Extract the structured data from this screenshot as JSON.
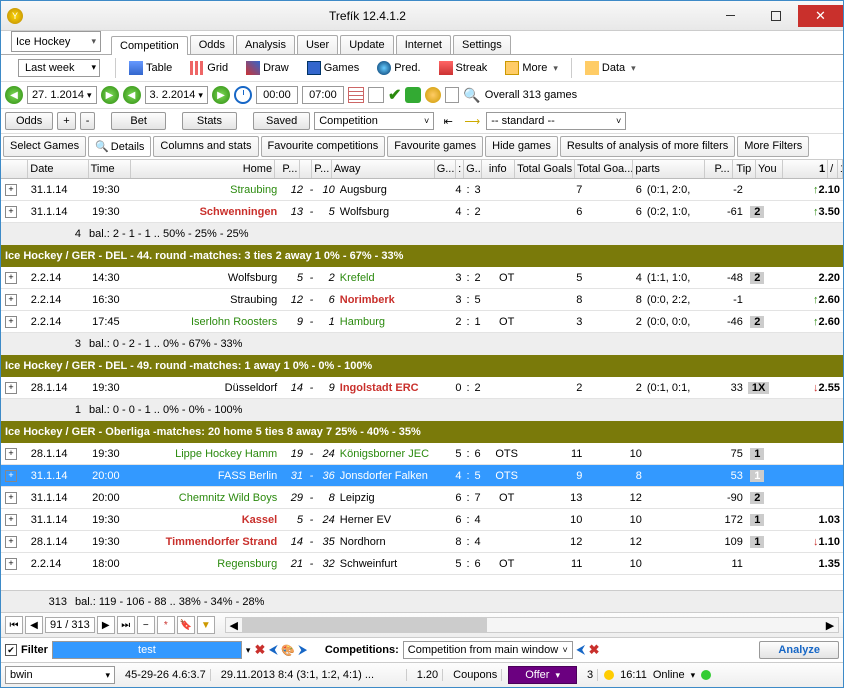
{
  "app": {
    "title": "Trefík 12.4.1.2"
  },
  "sport_dropdown": "Ice Hockey",
  "main_tabs": [
    "Competition",
    "Odds",
    "Analysis",
    "User",
    "Update",
    "Internet",
    "Settings"
  ],
  "main_tab_active": 0,
  "period_dropdown": "Last week",
  "toolbar1": {
    "table": "Table",
    "grid": "Grid",
    "draw": "Draw",
    "games": "Games",
    "pred": "Pred.",
    "streak": "Streak",
    "more": "More",
    "data": "Data"
  },
  "datebar": {
    "from": "27. 1.2014",
    "to": "3. 2.2014",
    "time_from": "00:00",
    "time_to": "07:00",
    "overall": "Overall 313 games"
  },
  "actionbar": {
    "odds": "Odds",
    "plus": "+",
    "minus": "-",
    "bet": "Bet",
    "stats": "Stats",
    "saved": "Saved",
    "combo": "Competition",
    "combo2": "-- standard --"
  },
  "subtabs": [
    "Select Games",
    "Details",
    "Columns and stats",
    "Favourite competitions",
    "Favourite games",
    "Hide games",
    "Results of analysis of more filters",
    "More Filters"
  ],
  "subtab_active": 1,
  "columns": [
    "Date",
    "Time",
    "Home",
    "P...",
    "P...",
    "Away",
    "G...",
    ":",
    "G...",
    "info",
    "Total Goals",
    "Total Goa...",
    "parts",
    "P...",
    "Tip",
    "You",
    "1",
    "/",
    "1..."
  ],
  "rows": [
    {
      "t": "row",
      "date": "31.1.14",
      "time": "19:30",
      "home": "Straubing",
      "hcls": "home-green",
      "p1": "12",
      "p2": "10",
      "away": "Augsburg",
      "g1": "4",
      "g2": "3",
      "info": "",
      "tg": "7",
      "tg2": "6",
      "parts": "(0:1, 2:0,",
      "px": "-2",
      "tip": "",
      "arrow": "up",
      "r1": "2.10"
    },
    {
      "t": "row",
      "date": "31.1.14",
      "time": "19:30",
      "home": "Schwenningen",
      "hcls": "home-red",
      "p1": "13",
      "p2": "5",
      "away": "Wolfsburg",
      "g1": "4",
      "g2": "2",
      "info": "",
      "tg": "6",
      "tg2": "6",
      "parts": "(0:2, 1:0,",
      "px": "-61",
      "tip": "2",
      "arrow": "up",
      "r1": "3.50"
    },
    {
      "t": "bal",
      "count": "4",
      "text": "bal.: 2 - 1 - 1 .. 50% - 25% - 25%"
    },
    {
      "t": "grp",
      "text": "Ice Hockey / GER - DEL - 44. round -matches: 3    ties 2   away 1      0% - 67% - 33%"
    },
    {
      "t": "row",
      "date": "2.2.14",
      "time": "14:30",
      "home": "Wolfsburg",
      "hcls": "",
      "p1": "5",
      "p2": "2",
      "away": "Krefeld",
      "acls": "away-green",
      "g1": "3",
      "g2": "2",
      "info": "OT",
      "tg": "5",
      "tg2": "4",
      "parts": "(1:1, 1:0,",
      "px": "-48",
      "tip": "2",
      "arrow": "",
      "r1": "2.20"
    },
    {
      "t": "row",
      "date": "2.2.14",
      "time": "16:30",
      "home": "Straubing",
      "hcls": "",
      "p1": "12",
      "p2": "6",
      "away": "Norimberk",
      "acls": "away-red",
      "g1": "3",
      "g2": "5",
      "info": "",
      "tg": "8",
      "tg2": "8",
      "parts": "(0:0, 2:2,",
      "px": "-1",
      "tip": "",
      "arrow": "up",
      "r1": "2.60"
    },
    {
      "t": "row",
      "date": "2.2.14",
      "time": "17:45",
      "home": "Iserlohn Roosters",
      "hcls": "home-green",
      "p1": "9",
      "p2": "1",
      "away": "Hamburg",
      "acls": "away-green",
      "g1": "2",
      "g2": "1",
      "info": "OT",
      "tg": "3",
      "tg2": "2",
      "parts": "(0:0, 0:0,",
      "px": "-46",
      "tip": "2",
      "arrow": "up",
      "r1": "2.60"
    },
    {
      "t": "bal",
      "count": "3",
      "text": "bal.: 0 - 2 - 1 .. 0% - 67% - 33%"
    },
    {
      "t": "grp",
      "text": "Ice Hockey / GER - DEL - 49. round -matches: 1      away 1      0% - 0% - 100%"
    },
    {
      "t": "row",
      "date": "28.1.14",
      "time": "19:30",
      "home": "Düsseldorf",
      "hcls": "",
      "p1": "14",
      "p2": "9",
      "away": "Ingolstadt ERC",
      "acls": "away-red",
      "g1": "0",
      "g2": "2",
      "info": "",
      "tg": "2",
      "tg2": "2",
      "parts": "(0:1, 0:1,",
      "px": "33",
      "tip": "1X",
      "arrow": "dn",
      "r1": "2.55"
    },
    {
      "t": "bal",
      "count": "1",
      "text": "bal.: 0 - 0 - 1 .. 0% - 0% - 100%"
    },
    {
      "t": "grp",
      "text": "Ice Hockey / GER - Oberliga -matches: 20   home 5   ties 8   away 7      25% - 40% - 35%"
    },
    {
      "t": "row",
      "date": "28.1.14",
      "time": "19:30",
      "home": "Lippe Hockey Hamm",
      "hcls": "home-green",
      "p1": "19",
      "p2": "24",
      "away": "Königsborner JEC",
      "acls": "away-green",
      "g1": "5",
      "g2": "6",
      "info": "OTS",
      "tg": "11",
      "tg2": "10",
      "parts": "",
      "px": "75",
      "tip": "1",
      "arrow": "",
      "r1": ""
    },
    {
      "t": "row",
      "sel": true,
      "date": "31.1.14",
      "time": "20:00",
      "home": "FASS Berlin",
      "hcls": "",
      "p1": "31",
      "p2": "36",
      "away": "Jonsdorfer Falken",
      "g1": "4",
      "g2": "5",
      "info": "OTS",
      "tg": "9",
      "tg2": "8",
      "parts": "",
      "px": "53",
      "tip": "1",
      "arrow": "",
      "r1": ""
    },
    {
      "t": "row",
      "date": "31.1.14",
      "time": "20:00",
      "home": "Chemnitz Wild Boys",
      "hcls": "home-green",
      "p1": "29",
      "p2": "8",
      "away": "Leipzig",
      "g1": "6",
      "g2": "7",
      "info": "OT",
      "tg": "13",
      "tg2": "12",
      "parts": "",
      "px": "-90",
      "tip": "2",
      "arrow": "",
      "r1": ""
    },
    {
      "t": "row",
      "date": "31.1.14",
      "time": "19:30",
      "home": "Kassel",
      "hcls": "home-red",
      "p1": "5",
      "p2": "24",
      "away": "Herner EV",
      "g1": "6",
      "g2": "4",
      "info": "",
      "tg": "10",
      "tg2": "10",
      "parts": "",
      "px": "172",
      "tip": "1",
      "arrow": "",
      "r1": "1.03"
    },
    {
      "t": "row",
      "date": "28.1.14",
      "time": "19:30",
      "home": "Timmendorfer Strand",
      "hcls": "home-red",
      "p1": "14",
      "p2": "35",
      "away": "Nordhorn",
      "g1": "8",
      "g2": "4",
      "info": "",
      "tg": "12",
      "tg2": "12",
      "parts": "",
      "px": "109",
      "tip": "1",
      "arrow": "dn",
      "r1": "1.10"
    },
    {
      "t": "row",
      "date": "2.2.14",
      "time": "18:00",
      "home": "Regensburg",
      "hcls": "home-green",
      "p1": "21",
      "p2": "32",
      "away": "Schweinfurt",
      "g1": "5",
      "g2": "6",
      "info": "OT",
      "tg": "11",
      "tg2": "10",
      "parts": "",
      "px": "11",
      "tip": "",
      "arrow": "",
      "r1": "1.35"
    }
  ],
  "summary": {
    "count": "313",
    "text": "bal.: 119 - 106 - 88 .. 38% - 34% - 28%"
  },
  "pager": {
    "pos": "91 / 313"
  },
  "filter": {
    "label": "Filter",
    "name": "test",
    "comp_label": "Competitions:",
    "comp_combo": "Competition from main window",
    "analyze": "Analyze"
  },
  "status": {
    "bookie": "bwin",
    "cols": "45-29-26  4.6:3.7",
    "hist": "29.11.2013 8:4 (3:1, 1:2, 4:1) ...",
    "odds": "1.20",
    "coupons": "Coupons",
    "offer": "Offer",
    "n": "3",
    "time": "16:11",
    "online": "Online"
  }
}
